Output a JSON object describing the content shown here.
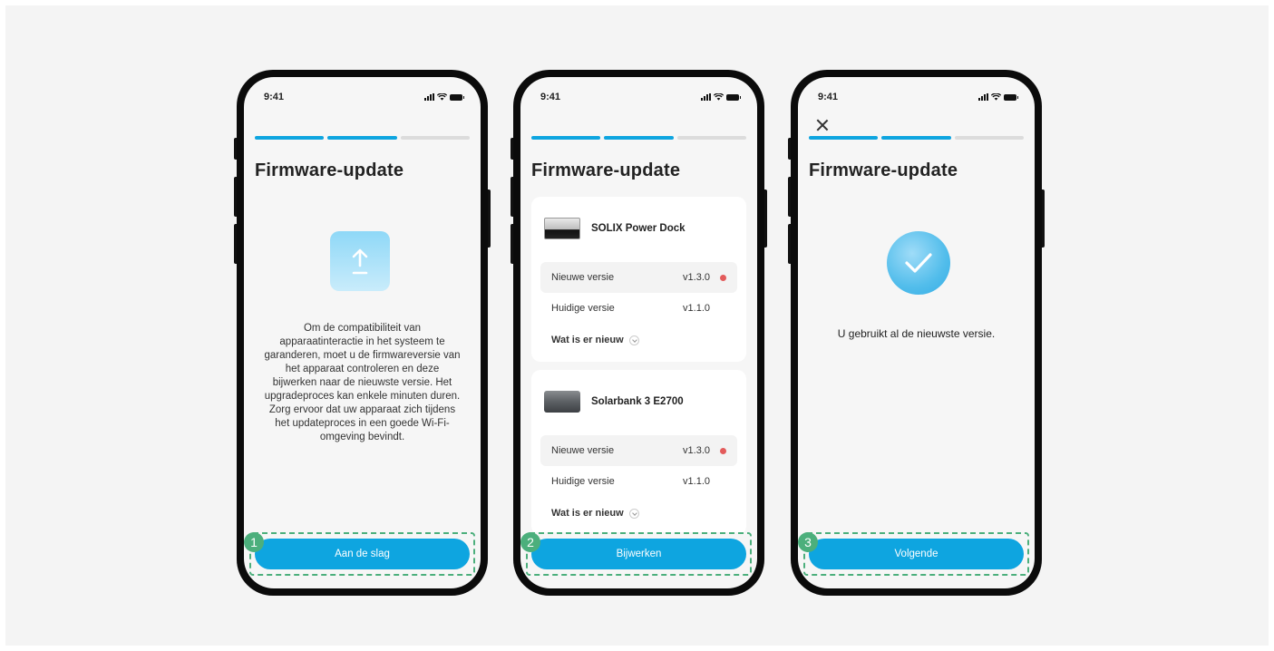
{
  "screens": [
    {
      "status_time": "9:41",
      "title": "Firmware-update",
      "progress": [
        true,
        true,
        false
      ],
      "icon": "upload-icon",
      "description": "Om de compatibiliteit van apparaatinteractie in het systeem te garanderen, moet u de firmwareversie van het apparaat controleren en deze bijwerken naar de nieuwste versie. Het upgradeproces kan enkele minuten duren. Zorg ervoor dat uw apparaat zich tijdens het updateproces in een goede Wi-Fi-omgeving bevindt.",
      "button_label": "Aan de slag",
      "step": "1"
    },
    {
      "status_time": "9:41",
      "title": "Firmware-update",
      "progress": [
        true,
        true,
        false
      ],
      "devices": [
        {
          "name": "SOLIX Power Dock",
          "new_label": "Nieuwe versie",
          "new_value": "v1.3.0",
          "current_label": "Huidige versie",
          "current_value": "v1.1.0",
          "whats_new": "Wat is er nieuw"
        },
        {
          "name": "Solarbank 3 E2700",
          "new_label": "Nieuwe versie",
          "new_value": "v1.3.0",
          "current_label": "Huidige versie",
          "current_value": "v1.1.0",
          "whats_new": "Wat is er nieuw"
        }
      ],
      "button_label": "Bijwerken",
      "step": "2"
    },
    {
      "status_time": "9:41",
      "title": "Firmware-update",
      "progress": [
        true,
        true,
        false
      ],
      "icon": "check-icon",
      "message": "U gebruikt al de nieuwste versie.",
      "button_label": "Volgende",
      "step": "3"
    }
  ],
  "colors": {
    "accent": "#0ea5e0",
    "step_badge": "#4caf7c",
    "update_dot": "#e35b5b",
    "background": "#f4f4f4"
  }
}
